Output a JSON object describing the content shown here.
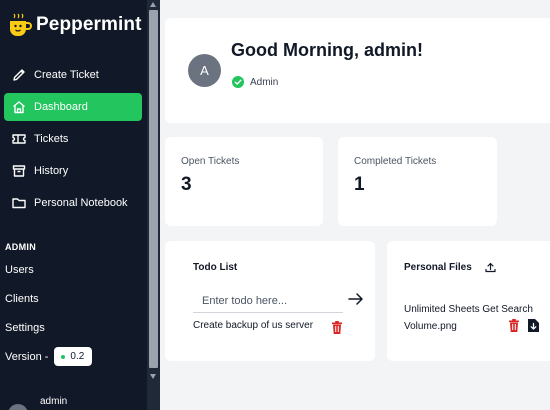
{
  "app": {
    "name": "Peppermint"
  },
  "sidebar": {
    "items": [
      {
        "label": "Create Ticket",
        "icon": "pencil-icon"
      },
      {
        "label": "Dashboard",
        "icon": "home-icon",
        "active": true
      },
      {
        "label": "Tickets",
        "icon": "ticket-icon"
      },
      {
        "label": "History",
        "icon": "archive-icon"
      },
      {
        "label": "Personal Notebook",
        "icon": "folder-icon"
      }
    ],
    "admin_heading": "ADMIN",
    "admin_links": [
      "Users",
      "Clients",
      "Settings"
    ],
    "version_label": "Version -",
    "version_value": "0.2",
    "user_name": "admin"
  },
  "greeting": {
    "avatar_initial": "A",
    "title": "Good Morning, admin!",
    "role": "Admin"
  },
  "stats": {
    "open_label": "Open Tickets",
    "open_value": "3",
    "completed_label": "Completed Tickets",
    "completed_value": "1"
  },
  "todo": {
    "title": "Todo List",
    "placeholder": "Enter todo here...",
    "items": [
      "Create backup of us server"
    ]
  },
  "files": {
    "title": "Personal Files",
    "items": [
      "Unlimited Sheets Get Search Volume.png"
    ]
  },
  "colors": {
    "sidebar_bg": "#111827",
    "accent": "#22c55e",
    "danger": "#dc2626",
    "page_bg": "#f3f4f6"
  }
}
